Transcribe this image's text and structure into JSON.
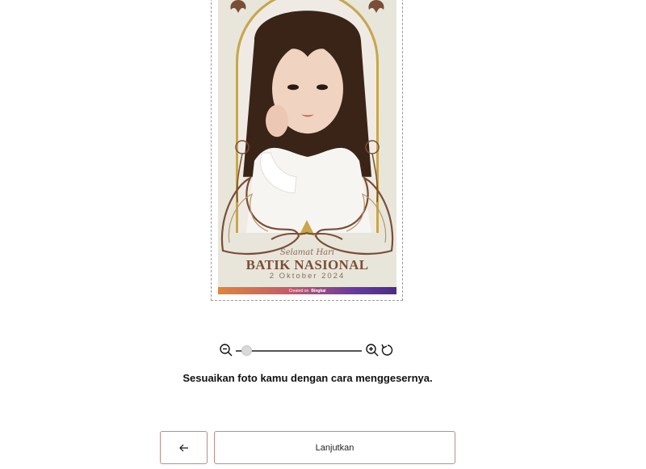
{
  "frame": {
    "greeting_line1": "Selamat Hari",
    "greeting_line2": "BATIK NASIONAL",
    "greeting_line3": "2 Oktober 2024",
    "credit_prefix": "Created on",
    "credit_brand": "Bingkai",
    "accent_gold": "#c8a64a",
    "ornament_brown": "#7a4e36"
  },
  "zoom": {
    "level": 0.05,
    "zoom_out_icon": "zoom-out-icon",
    "zoom_in_icon": "zoom-in-icon",
    "reset_icon": "rotate-reset-icon"
  },
  "instruction": "Sesuaikan foto kamu dengan cara menggesernya.",
  "nav": {
    "back_icon": "arrow-left-icon",
    "next_label": "Lanjutkan",
    "border_color": "#c08a8a"
  }
}
